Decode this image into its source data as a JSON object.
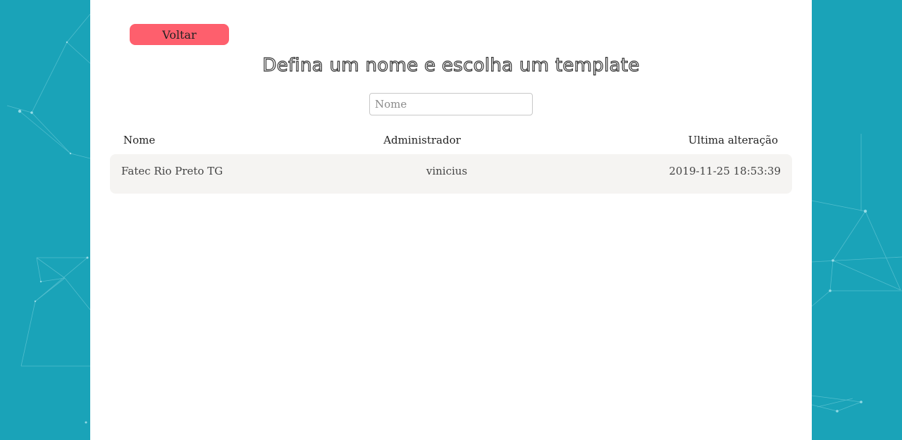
{
  "back_button": {
    "label": "Voltar"
  },
  "title": "Defina um nome e escolha um template",
  "name_input": {
    "placeholder": "Nome",
    "value": ""
  },
  "table": {
    "headers": [
      "Nome",
      "Administrador",
      "Ultima alteração"
    ],
    "rows": [
      [
        "Fatec Rio Preto TG",
        "vinicius",
        "2019-11-25 18:53:39"
      ]
    ]
  },
  "colors": {
    "background": "#1aa3b8",
    "panel": "#ffffff",
    "back_button": "#fe5f6d",
    "row_background": "#f5f4f2"
  }
}
